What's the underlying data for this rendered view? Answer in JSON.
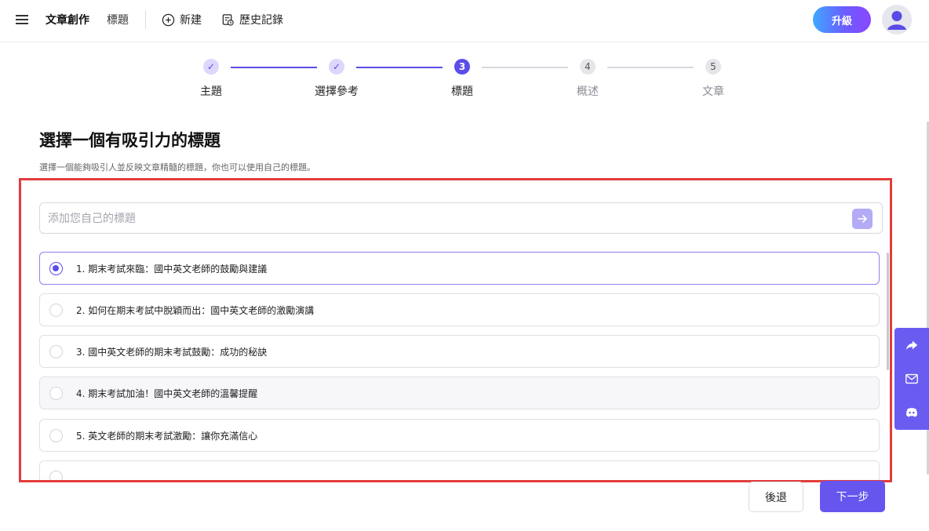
{
  "header": {
    "app_title": "文章創作",
    "crumb": "標題",
    "new_label": "新建",
    "history_label": "歷史記錄",
    "upgrade_label": "升級"
  },
  "stepper": {
    "steps": [
      {
        "badge": "✓",
        "label": "主題",
        "state": "done"
      },
      {
        "badge": "✓",
        "label": "選擇參考",
        "state": "done"
      },
      {
        "badge": "3",
        "label": "標題",
        "state": "active"
      },
      {
        "badge": "4",
        "label": "概述",
        "state": "todo"
      },
      {
        "badge": "5",
        "label": "文章",
        "state": "todo"
      }
    ]
  },
  "main": {
    "heading": "選擇一個有吸引力的標題",
    "subheading": "選擇一個能夠吸引人並反映文章精髓的標題，你也可以使用自己的標題。",
    "own_title_placeholder": "添加您自己的標題",
    "options": [
      "1. 期末考試來臨：國中英文老師的鼓勵與建議",
      "2. 如何在期末考試中脫穎而出：國中英文老師的激勵演講",
      "3. 國中英文老師的期末考試鼓勵：成功的秘訣",
      "4. 期末考試加油！國中英文老師的溫馨提醒",
      "5. 英文老師的期末考試激勵：讓你充滿信心"
    ],
    "selected_index": 0
  },
  "footer": {
    "back_label": "後退",
    "next_label": "下一步"
  },
  "colors": {
    "accent": "#5b4de9",
    "highlight_border": "#e23c3c",
    "sidebar": "#6a5cf0"
  }
}
